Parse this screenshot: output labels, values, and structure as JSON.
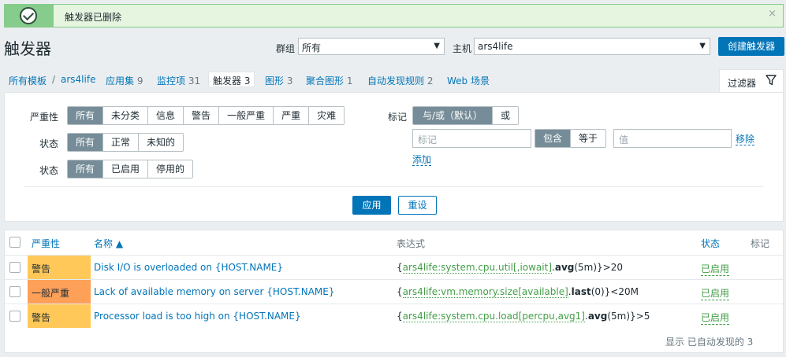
{
  "message": {
    "text": "触发器已删除",
    "close": "×"
  },
  "header": {
    "title": "触发器",
    "group_label": "群组",
    "group_value": "所有",
    "host_label": "主机",
    "host_value": "ars4life",
    "create_button": "创建触发器"
  },
  "nav": {
    "all_templates": "所有模板",
    "separator": "/",
    "host": "ars4life",
    "items": [
      {
        "label": "应用集",
        "count": "9"
      },
      {
        "label": "监控项",
        "count": "31"
      },
      {
        "label": "触发器",
        "count": "3"
      },
      {
        "label": "图形",
        "count": "3"
      },
      {
        "label": "聚合图形",
        "count": "1"
      },
      {
        "label": "自动发现规则",
        "count": "2"
      },
      {
        "label": "Web 场景",
        "count": ""
      }
    ],
    "filter_tab": "过滤器"
  },
  "filter": {
    "severity_label": "严重性",
    "severity_options": [
      "所有",
      "未分类",
      "信息",
      "警告",
      "一般严重",
      "严重",
      "灾难"
    ],
    "state_label": "状态",
    "state_options": [
      "所有",
      "正常",
      "未知的"
    ],
    "status_label": "状态",
    "status_options": [
      "所有",
      "已启用",
      "停用的"
    ],
    "tags_label": "标记",
    "tags_mode_options": [
      "与/或（默认）",
      "或"
    ],
    "tag_placeholder": "标记",
    "tag_operator_options": [
      "包含",
      "等于"
    ],
    "value_placeholder": "值",
    "remove_link": "移除",
    "add_link": "添加",
    "apply_button": "应用",
    "reset_button": "重设"
  },
  "table": {
    "headers": {
      "severity": "严重性",
      "name": "名称 ▲",
      "expression": "表达式",
      "status": "状态",
      "tags": "标记"
    },
    "rows": [
      {
        "severity": "警告",
        "severity_color": "#ffc859",
        "name": "Disk I/O is overloaded on {HOST.NAME}",
        "expr_open": "{",
        "expr_key": "ars4life:system.cpu.util[,iowait]",
        "expr_dot": ".",
        "expr_fn": "avg",
        "expr_rest": "(5m)}>20",
        "status": "已启用"
      },
      {
        "severity": "一般严重",
        "severity_color": "#ffa059",
        "name": "Lack of available memory on server {HOST.NAME}",
        "expr_open": "{",
        "expr_key": "ars4life:vm.memory.size[available]",
        "expr_dot": ".",
        "expr_fn": "last",
        "expr_rest": "(0)}<20M",
        "status": "已启用"
      },
      {
        "severity": "警告",
        "severity_color": "#ffc859",
        "name": "Processor load is too high on {HOST.NAME}",
        "expr_open": "{",
        "expr_key": "ars4life:system.cpu.load[percpu,avg1]",
        "expr_dot": ".",
        "expr_fn": "avg",
        "expr_rest": "(5m)}>5",
        "status": "已启用"
      }
    ],
    "footer": "显示 已自动发现的 3"
  }
}
